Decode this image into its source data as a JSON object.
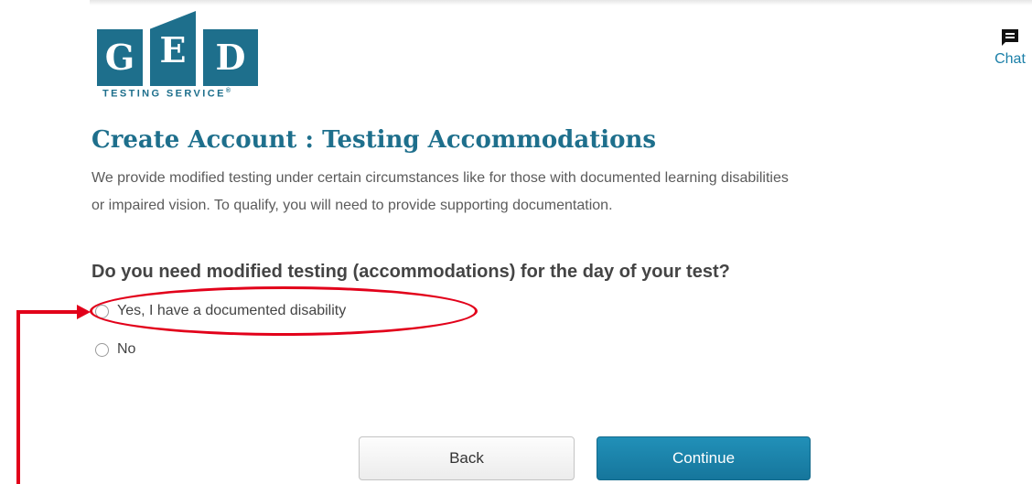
{
  "logo": {
    "letters": [
      "G",
      "E",
      "D"
    ],
    "caption": "TESTING SERVICE",
    "registered_mark": "®"
  },
  "chat": {
    "label": "Chat",
    "icon": "chat-bubble-icon"
  },
  "page": {
    "title": "Create Account : Testing Accommodations",
    "intro_line_1": "We provide modified testing under certain circumstances like for those with documented learning disabilities",
    "intro_line_2": "or impaired vision. To qualify, you will need to provide supporting documentation."
  },
  "form": {
    "question": "Do you need modified testing (accommodations) for the day of your test?",
    "options": [
      {
        "label": "Yes, I have a documented disability",
        "selected": false
      },
      {
        "label": "No",
        "selected": false
      }
    ]
  },
  "buttons": {
    "back_label": "Back",
    "continue_label": "Continue"
  },
  "colors": {
    "brand": "#1e6f8c",
    "link": "#1a7fa8",
    "primary_button": "#1a84ad",
    "annotation": "#e2001a"
  }
}
